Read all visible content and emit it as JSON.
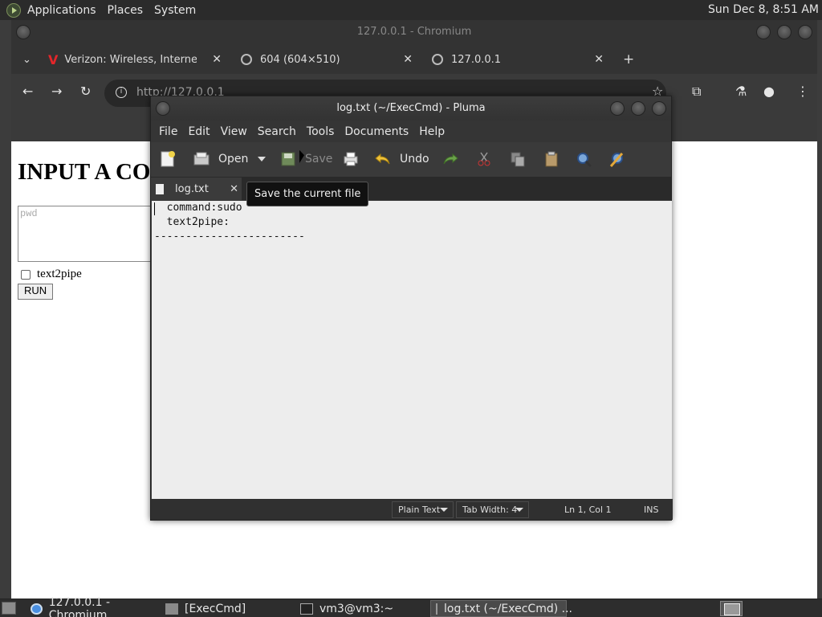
{
  "top_panel": {
    "menus": [
      "Applications",
      "Places",
      "System"
    ],
    "clock": "Sun Dec  8,  8:51 AM"
  },
  "chromium": {
    "title": "127.0.0.1 - Chromium",
    "tabs": [
      {
        "label": "Verizon: Wireless, Internet, T",
        "icon": "verizon-logo-icon"
      },
      {
        "label": "604 (604×510)",
        "icon": "globe-icon"
      },
      {
        "label": "127.0.0.1",
        "icon": "globe-icon"
      }
    ],
    "omnibox_url": "http://127.0.0.1"
  },
  "webpage": {
    "heading": "INPUT A CO",
    "textarea_placeholder": "pwd",
    "checkbox_label": "text2pipe",
    "run_label": "RUN"
  },
  "pluma": {
    "title": "log.txt (~/ExecCmd) - Pluma",
    "menu": [
      "File",
      "Edit",
      "View",
      "Search",
      "Tools",
      "Documents",
      "Help"
    ],
    "toolbar": {
      "open_label": "Open",
      "save_label": "Save",
      "undo_label": "Undo"
    },
    "doc_tab": "log.txt",
    "tooltip": "Save the current file",
    "editor_lines": [
      "  command:sudo",
      "  text2pipe:",
      "------------------------"
    ],
    "status": {
      "syntax": "Plain Text",
      "tab_width": "Tab Width:  4",
      "position": "Ln 1, Col 1",
      "mode": "INS"
    }
  },
  "taskbar": {
    "tasks": [
      {
        "label": "127.0.0.1 - Chromium",
        "icon": "chromium-icon"
      },
      {
        "label": "[ExecCmd]",
        "icon": "folder-icon"
      },
      {
        "label": "vm3@vm3:~",
        "icon": "terminal-icon"
      },
      {
        "label": "log.txt (~/ExecCmd) ...",
        "icon": "text-editor-icon"
      }
    ]
  },
  "colors": {
    "verizon_red": "#e3262a",
    "panel_bg": "#2b2b2b",
    "editor_bg": "#ededed"
  }
}
